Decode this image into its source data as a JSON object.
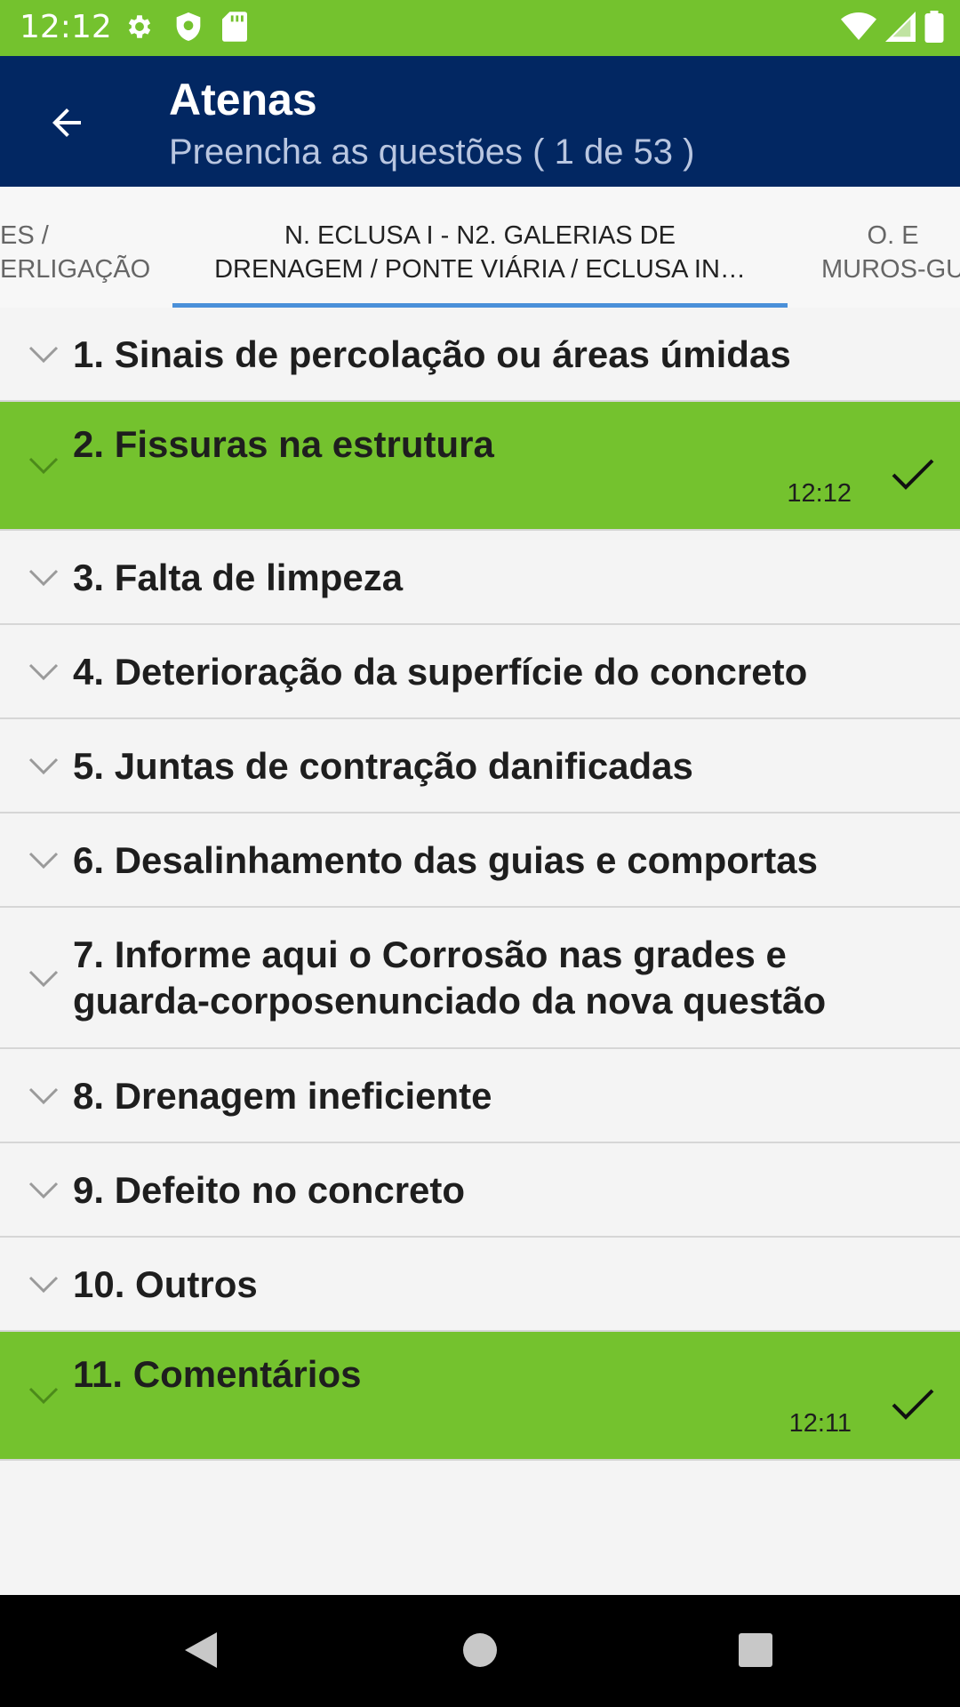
{
  "status_bar": {
    "time": "12:12",
    "icons_left": [
      "settings-icon",
      "shield-icon",
      "sd-card-icon"
    ],
    "icons_right": [
      "wifi-icon",
      "signal-icon",
      "battery-icon"
    ]
  },
  "app_bar": {
    "title": "Atenas",
    "subtitle": "Preencha as questões ( 1 de 53 )"
  },
  "tabs": {
    "left": {
      "line1": "ES /",
      "line2": "ERLIGAÇÃO"
    },
    "active": {
      "line1": "N. ECLUSA I - N2. GALERIAS DE",
      "line2": "DRENAGEM / PONTE VIÁRIA / ECLUSA IN…"
    },
    "right": {
      "line1": "O. E",
      "line2": "MUROS-GU"
    }
  },
  "items": [
    {
      "label": "1. Sinais de percolação ou áreas úmidas",
      "done": false
    },
    {
      "label": "2. Fissuras na estrutura",
      "done": true,
      "time": "12:12"
    },
    {
      "label": "3. Falta de limpeza",
      "done": false
    },
    {
      "label": "4. Deterioração da superfície do concreto",
      "done": false
    },
    {
      "label": "5. Juntas de contração danificadas",
      "done": false
    },
    {
      "label": "6. Desalinhamento das guias e comportas",
      "done": false
    },
    {
      "label_line1": "7. Informe aqui o Corrosão nas grades e",
      "label_line2": "guarda-corposenunciado da nova questão",
      "done": false
    },
    {
      "label": "8. Drenagem ineficiente",
      "done": false
    },
    {
      "label": "9. Defeito no concreto",
      "done": false
    },
    {
      "label": "10. Outros",
      "done": false
    },
    {
      "label": "11. Comentários",
      "done": true,
      "time": "12:11"
    }
  ],
  "colors": {
    "status_bar": "#74c22e",
    "app_bar": "#022762",
    "done_row": "#74c22e",
    "tab_indicator": "#4a90d9"
  },
  "nav_bar": [
    "back-triangle-icon",
    "home-circle-icon",
    "recents-square-icon"
  ]
}
